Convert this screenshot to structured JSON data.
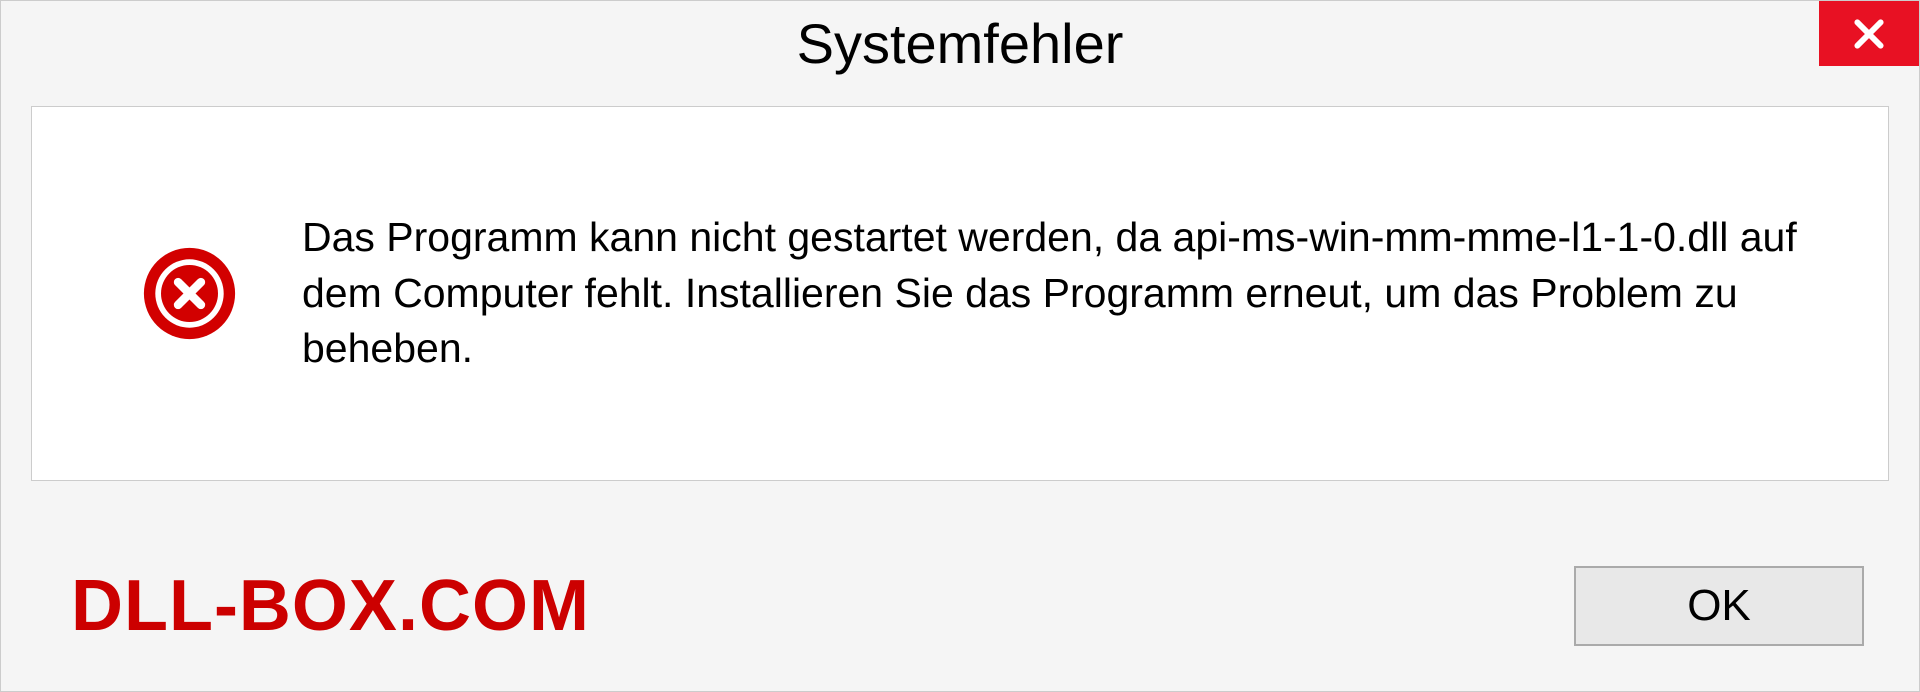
{
  "dialog": {
    "title": "Systemfehler",
    "message": "Das Programm kann nicht gestartet werden, da api-ms-win-mm-mme-l1-1-0.dll auf dem Computer fehlt. Installieren Sie das Programm erneut, um das Problem zu beheben.",
    "ok_label": "OK"
  },
  "watermark": "DLL-BOX.COM"
}
